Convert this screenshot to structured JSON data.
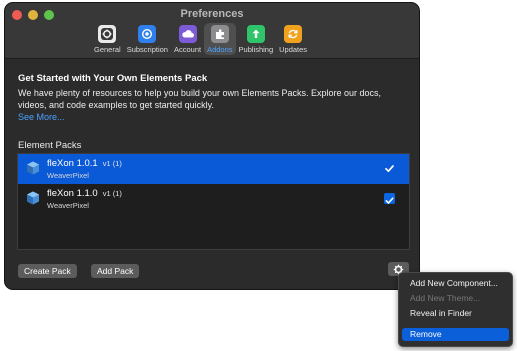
{
  "window": {
    "title": "Preferences",
    "tabs": [
      {
        "label": "General",
        "icon": "general-icon",
        "color": "#4a4a4c"
      },
      {
        "label": "Subscription",
        "icon": "subscription-icon",
        "color": "#2f80ed"
      },
      {
        "label": "Account",
        "icon": "account-icon",
        "color": "#7b5cd6"
      },
      {
        "label": "Addons",
        "icon": "addons-icon",
        "color": "#8a8a8c",
        "active": true
      },
      {
        "label": "Publishing",
        "icon": "publishing-icon",
        "color": "#2fc46a"
      },
      {
        "label": "Updates",
        "icon": "updates-icon",
        "color": "#f0a21e"
      }
    ]
  },
  "getting_started": {
    "title": "Get Started with Your Own Elements Pack",
    "description": "We have plenty of resources to help you build your own Elements Packs. Explore our docs, videos, and code examples to get started quickly.",
    "link": "See More..."
  },
  "element_packs": {
    "heading": "Element Packs",
    "items": [
      {
        "name": "fleXon 1.0.1",
        "version": "v1 (1)",
        "author": "WeaverPixel",
        "checked": true,
        "selected": true
      },
      {
        "name": "fleXon 1.1.0",
        "version": "v1 (1)",
        "author": "WeaverPixel",
        "checked": true,
        "selected": false
      }
    ]
  },
  "buttons": {
    "create_pack": "Create Pack",
    "add_pack": "Add Pack"
  },
  "context_menu": {
    "items": [
      {
        "label": "Add New Component...",
        "enabled": true
      },
      {
        "label": "Add New Theme...",
        "enabled": false
      },
      {
        "label": "Reveal in Finder",
        "enabled": true
      },
      {
        "label": "Remove",
        "enabled": true,
        "highlighted": true
      }
    ]
  },
  "colors": {
    "accent": "#0a59d6",
    "link": "#4aa0ff",
    "window_bg": "#2b2b2c"
  }
}
